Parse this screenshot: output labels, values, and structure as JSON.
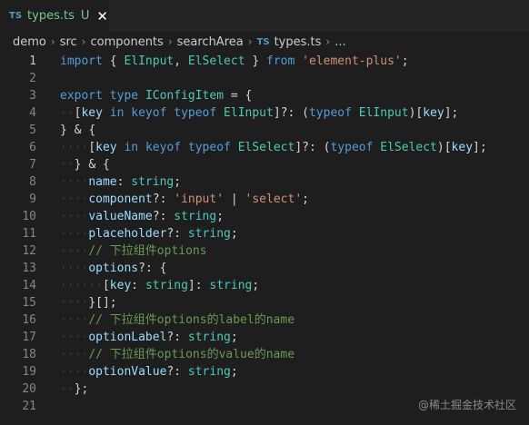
{
  "tab": {
    "badge": "TS",
    "title": "types.ts",
    "status": "U",
    "close": "✕"
  },
  "breadcrumb": {
    "items": [
      "demo",
      "src",
      "components",
      "searchArea"
    ],
    "file_badge": "TS",
    "file": "types.ts",
    "more": "..."
  },
  "code_lines": [
    {
      "n": "1",
      "text": "import { ElInput, ElSelect } from 'element-plus';"
    },
    {
      "n": "2",
      "text": ""
    },
    {
      "n": "3",
      "text": "export type IConfigItem = {"
    },
    {
      "n": "4",
      "text": "  [key in keyof typeof ElInput]?: (typeof ElInput)[key];"
    },
    {
      "n": "5",
      "text": "} & {"
    },
    {
      "n": "6",
      "text": "    [key in keyof typeof ElSelect]?: (typeof ElSelect)[key];"
    },
    {
      "n": "7",
      "text": "  } & {"
    },
    {
      "n": "8",
      "text": "    name: string;"
    },
    {
      "n": "9",
      "text": "    component?: 'input' | 'select';"
    },
    {
      "n": "10",
      "text": "    valueName?: string;"
    },
    {
      "n": "11",
      "text": "    placeholder?: string;"
    },
    {
      "n": "12",
      "text": "    // 下拉组件options"
    },
    {
      "n": "13",
      "text": "    options?: {"
    },
    {
      "n": "14",
      "text": "      [key: string]: string;"
    },
    {
      "n": "15",
      "text": "    }[];"
    },
    {
      "n": "16",
      "text": "    // 下拉组件options的label的name"
    },
    {
      "n": "17",
      "text": "    optionLabel?: string;"
    },
    {
      "n": "18",
      "text": "    // 下拉组件options的value的name"
    },
    {
      "n": "19",
      "text": "    optionValue?: string;"
    },
    {
      "n": "20",
      "text": "  };"
    },
    {
      "n": "21",
      "text": ""
    }
  ],
  "watermark": "@稀土掘金技术社区",
  "colors": {
    "background": "#1e1e1e",
    "keyword": "#569cd6",
    "type": "#4ec9b0",
    "variable": "#9cdcfe",
    "string": "#ce9178",
    "comment": "#6a9955",
    "modified": "#73c991"
  }
}
